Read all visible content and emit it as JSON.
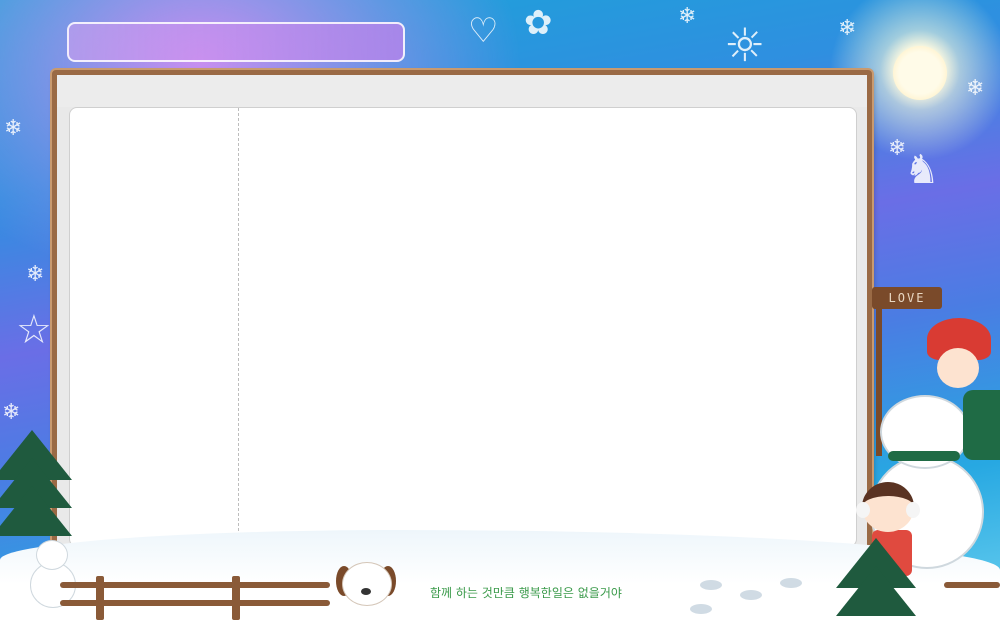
{
  "search": {
    "value": ""
  },
  "footer": {
    "caption": "함께 하는 것만큼 행복한일은 없을거야"
  },
  "decor": {
    "love_sign": "LOVE",
    "colors": {
      "frame_wood": "#9a6a45",
      "panel_bg": "#ffffff",
      "header_bg": "#ececec",
      "caption_text": "#3a9a4a"
    }
  }
}
